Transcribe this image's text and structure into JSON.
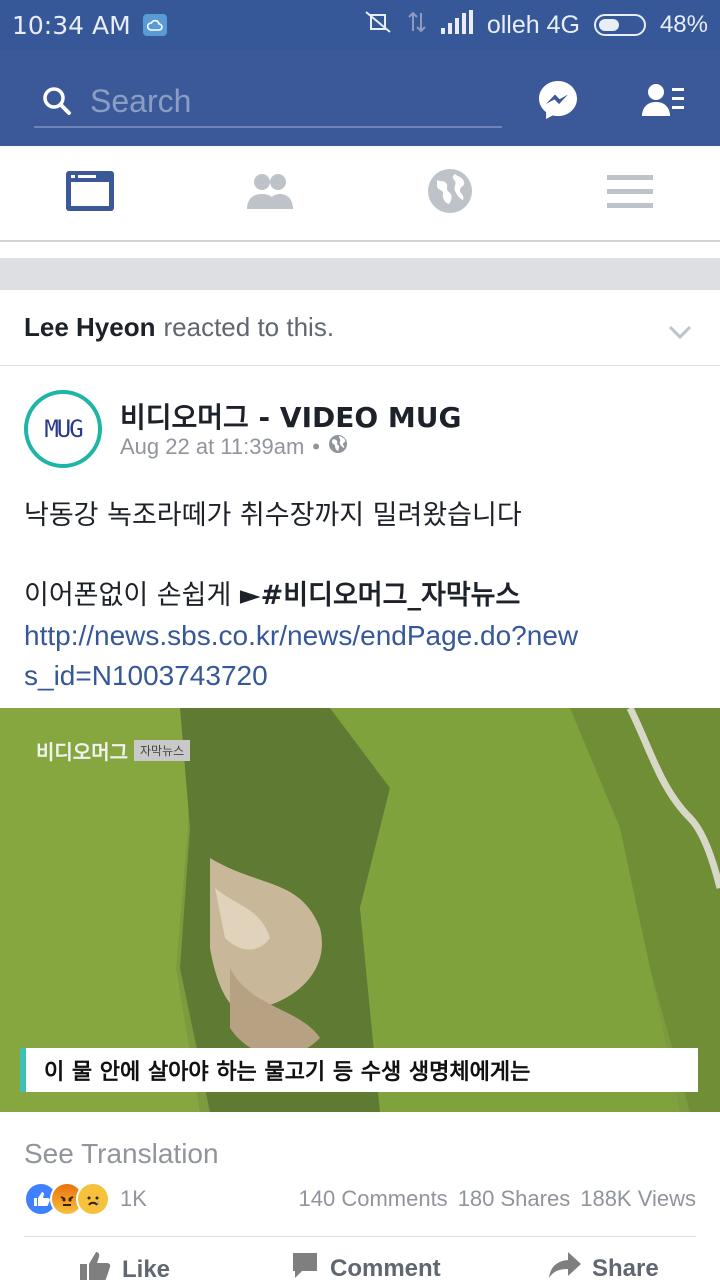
{
  "status_bar": {
    "time": "10:34 AM",
    "carrier": "olleh 4G",
    "battery": "48%",
    "battery_level": 0.48
  },
  "header": {
    "search_placeholder": "Search",
    "icons": [
      "search-icon",
      "messenger-icon",
      "friend-requests-icon"
    ],
    "bg_color": "#3b5998"
  },
  "nav": {
    "tabs": [
      "news-feed-icon",
      "friends-icon",
      "globe-icon",
      "menu-icon"
    ],
    "active_index": 0
  },
  "story": {
    "reactor_name": "Lee Hyeon",
    "reaction_text": "reacted to this."
  },
  "post": {
    "page_name": "비디오머그 - VIDEO MUG",
    "avatar_text": "MUG",
    "timestamp": "Aug 22 at 11:39am",
    "separator": "•",
    "line1": "낙동강 녹조라떼가 취수장까지 밀려왔습니다",
    "line2_prefix": "이어폰없이 손쉽게 ►",
    "hashtag": "#비디오머그_자막뉴스",
    "link": "http://news.sbs.co.kr/news/endPage.do?news_id=N1003743720",
    "see_translation": "See Translation"
  },
  "video": {
    "watermark_brand": "비디오머그",
    "watermark_tag": "자막뉴스",
    "subtitle": "이 물 안에 살아야 하는 물고기 등 수생 생명체에게는"
  },
  "engagement": {
    "reaction_count": "1K",
    "comments": "140 Comments",
    "shares": "180 Shares",
    "views": "188K Views"
  },
  "actions": {
    "like": "Like",
    "comment": "Comment",
    "share": "Share"
  }
}
